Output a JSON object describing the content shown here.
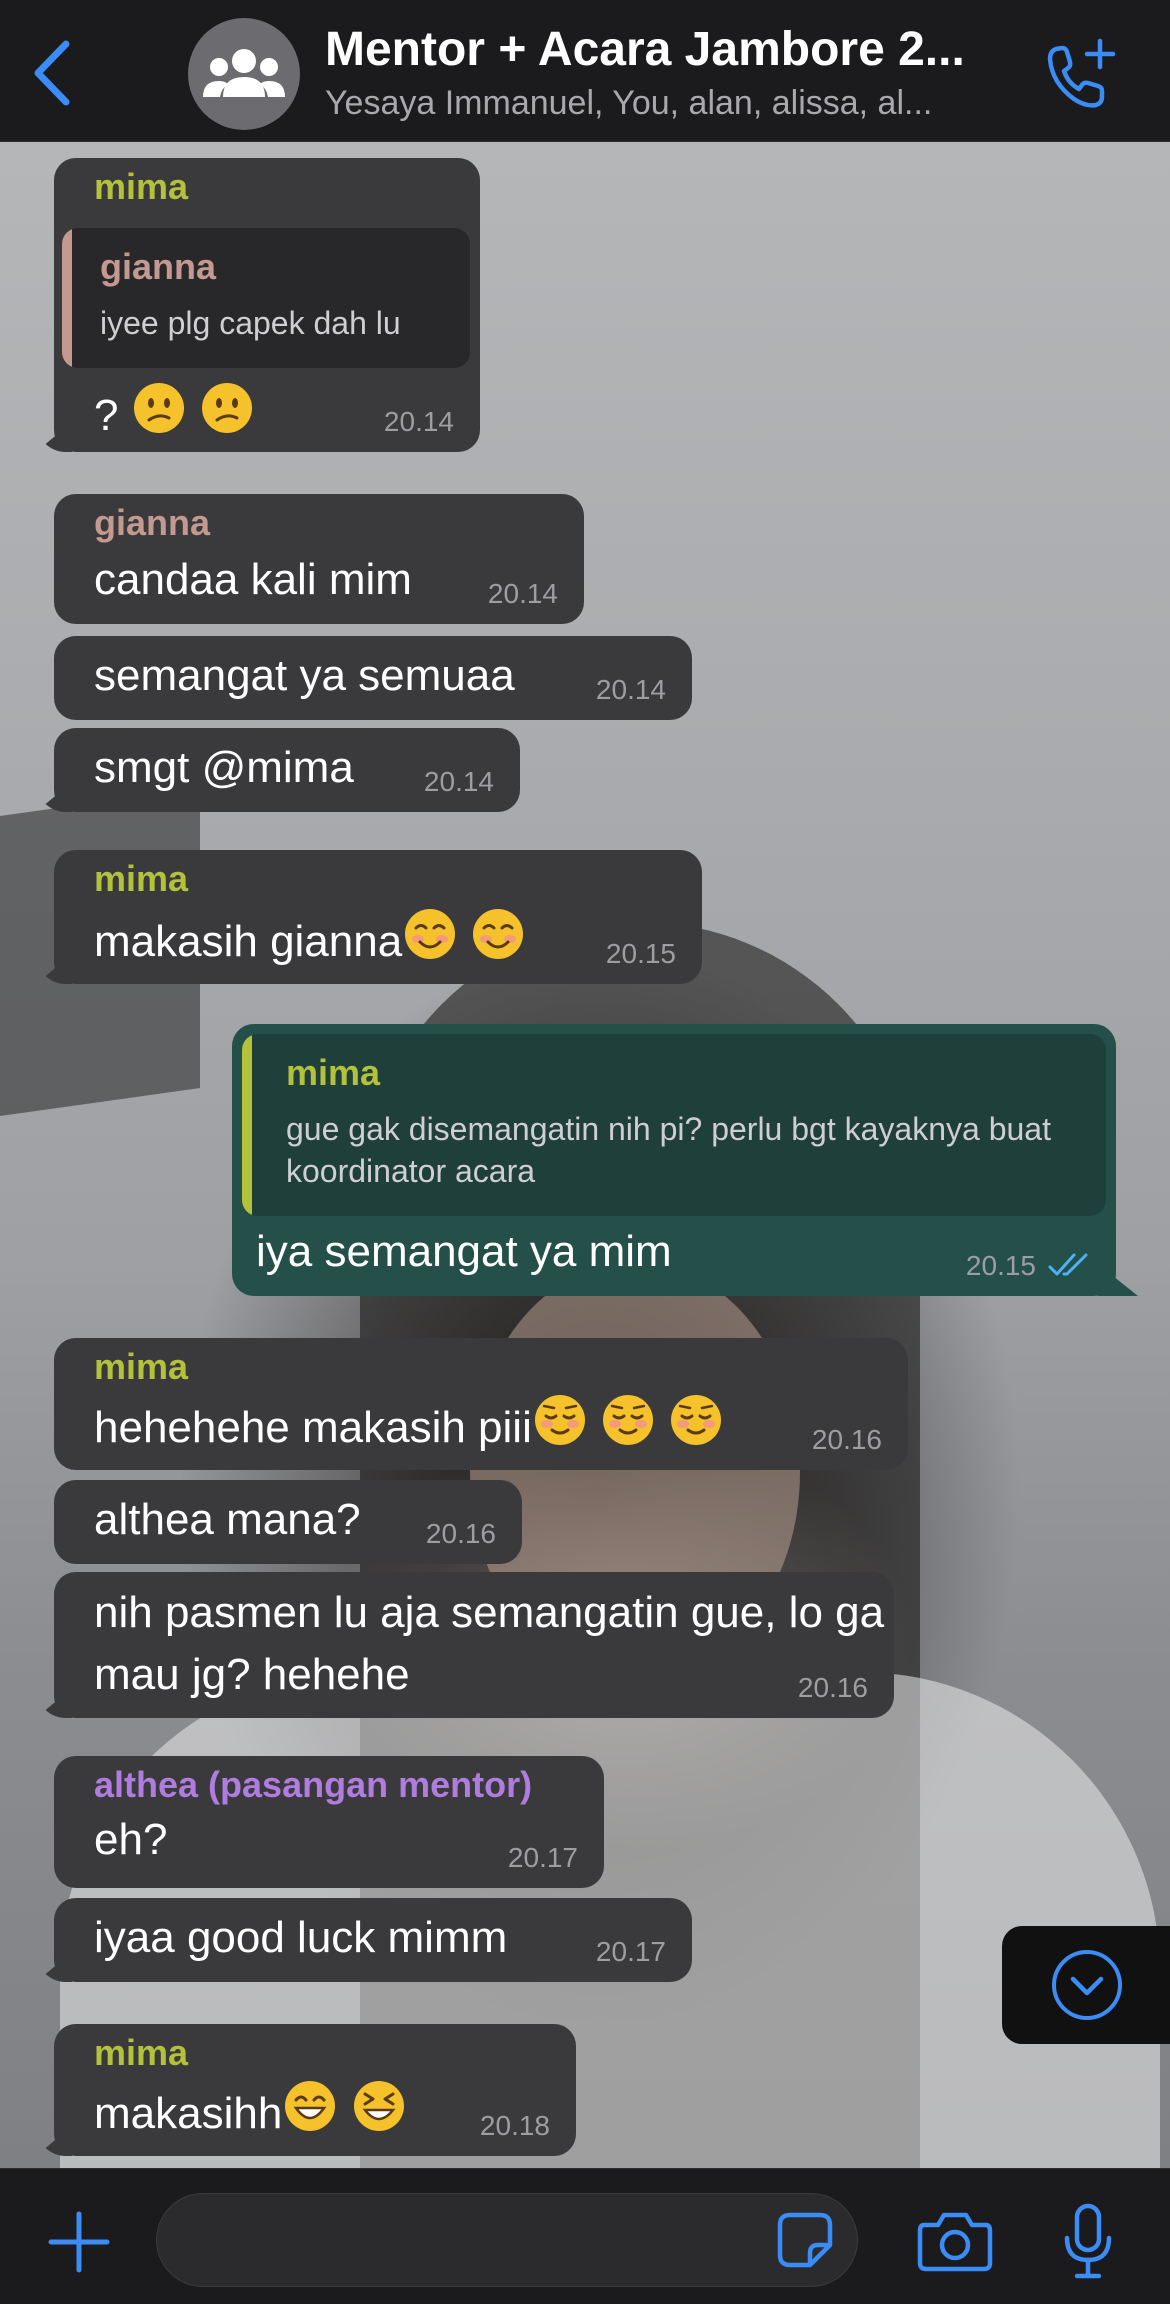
{
  "header": {
    "title": "Mentor + Acara Jambore 2...",
    "subtitle": "Yesaya Immanuel, You, alan, alissa, al..."
  },
  "colors": {
    "accent": "#3b8cf5",
    "incoming_bubble": "#3a3a3c",
    "outgoing_bubble": "#25504a",
    "name_mima": "#b4c13a",
    "name_gianna": "#c49a90",
    "name_althea": "#b07ce0"
  },
  "messages": [
    {
      "sender": "mima",
      "quote_name": "gianna",
      "quote_text": "iyee plg capek dah lu",
      "text": "? ",
      "time": "20.14"
    },
    {
      "sender": "gianna",
      "text": "candaa kali mim",
      "time": "20.14"
    },
    {
      "text": "semangat ya semuaa",
      "time": "20.14"
    },
    {
      "text": "smgt @mima",
      "time": "20.14"
    },
    {
      "sender": "mima",
      "text": "makasih gianna",
      "time": "20.15"
    },
    {
      "quote_name": "mima",
      "quote_text": "gue gak disemangatin nih pi? perlu bgt kayaknya buat koordinator acara",
      "text": "iya semangat ya mim",
      "time": "20.15"
    },
    {
      "sender": "mima",
      "text": "hehehehe makasih piii",
      "time": "20.16"
    },
    {
      "text": "althea mana?",
      "time": "20.16"
    },
    {
      "text": "nih pasmen lu aja semangatin gue, lo ga mau jg? hehehe",
      "time": "20.16"
    },
    {
      "sender": "althea (pasangan mentor)",
      "text": "eh?",
      "time": "20.17"
    },
    {
      "text": "iyaa good luck mimm",
      "time": "20.17"
    },
    {
      "sender": "mima",
      "text": "makasihh",
      "time": "20.18"
    }
  ],
  "icons": {
    "back": "chevron-left-icon",
    "avatar": "group-icon",
    "call": "add-call-icon",
    "scroll": "scroll-down-icon",
    "plus": "plus-icon",
    "sticker": "sticker-icon",
    "camera": "camera-icon",
    "mic": "microphone-icon"
  },
  "composer": {
    "value": "",
    "placeholder": ""
  }
}
